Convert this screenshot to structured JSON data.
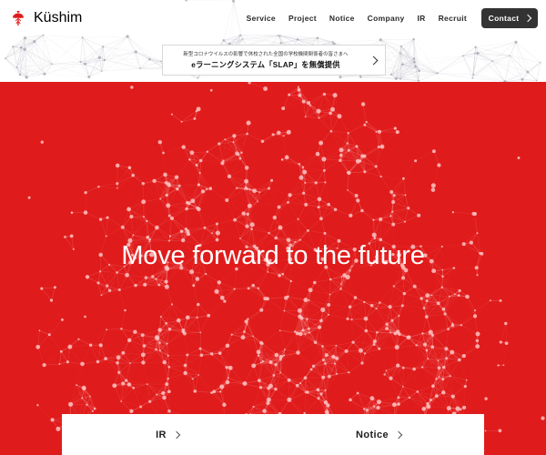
{
  "site": {
    "brand_name": "Küshim",
    "brand_mark_icon": "kushim-fan-logo-icon",
    "accent_red": "#e01b1b",
    "dark_button": "#333333"
  },
  "header": {
    "nav_items": [
      {
        "label": "Service",
        "name": "service"
      },
      {
        "label": "Project",
        "name": "project"
      },
      {
        "label": "Notice",
        "name": "notice"
      },
      {
        "label": "Company",
        "name": "company"
      },
      {
        "label": "IR",
        "name": "ir"
      },
      {
        "label": "Recruit",
        "name": "recruit"
      }
    ],
    "contact_button": {
      "label": "Contact",
      "icon": "chevron-right-icon"
    }
  },
  "banner": {
    "line1": "新型コロナウイルスの影響で休校された全国の学校機関関係者の皆さまへ",
    "line2": "eラーニングシステム「SLAP」を無償提供",
    "arrow_icon": "chevron-right-icon"
  },
  "hero": {
    "title": "Move forward to the future",
    "background_graphic": "network-particle-constellation"
  },
  "bottom_panel": {
    "links": [
      {
        "label": "IR",
        "name": "ir",
        "icon": "chevron-right-icon"
      },
      {
        "label": "Notice",
        "name": "notice",
        "icon": "chevron-right-icon"
      }
    ]
  }
}
